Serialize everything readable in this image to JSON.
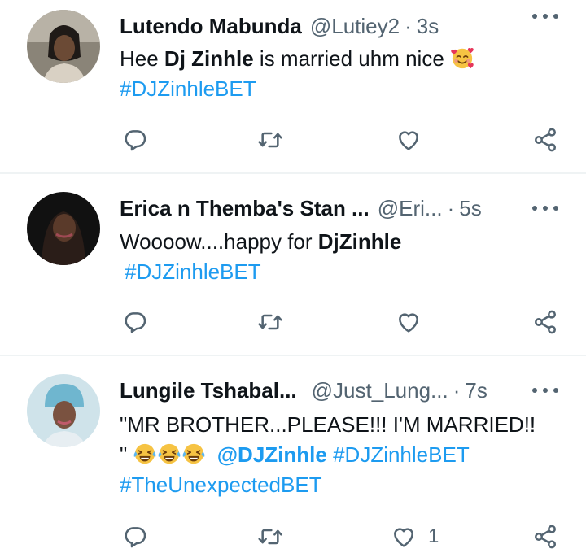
{
  "colors": {
    "link": "#1d9bf0",
    "muted": "#536471",
    "text": "#0f1419",
    "divider": "#eff3f4"
  },
  "tweets": [
    {
      "name": "Lutendo Mabunda",
      "handle": "@Lutiey2",
      "separator": "·",
      "time": "3s",
      "text_plain_1": "Hee ",
      "text_bold_1": "Dj Zinhle",
      "text_plain_2": " is married uhm nice ",
      "emoji": "smiling-face-with-hearts",
      "hashtag_1": "#DJZinhleBET",
      "like_count": ""
    },
    {
      "name": "Erica n Themba's Stan ...",
      "handle": "@Eri...",
      "separator": "·",
      "time": "5s",
      "text_plain_1": "Woooow....happy for ",
      "text_bold_1": "DjZinhle",
      "hashtag_1": "#DJZinhleBET",
      "like_count": ""
    },
    {
      "name": "Lungile Tshabal...",
      "handle": "@Just_Lung...",
      "separator": "·",
      "time": "7s",
      "text_line_1": "\"MR BROTHER...PLEASE!!! I'M MARRIED!!",
      "text_line_2": "\" ",
      "emoji": "face-with-tears-of-joy",
      "mention": "@DJZinhle",
      "hashtag_1": "#DJZinhleBET",
      "hashtag_2": "#TheUnexpectedBET",
      "like_count": "1"
    }
  ],
  "icons": [
    "reply-icon",
    "retweet-icon",
    "like-icon",
    "share-icon",
    "more-icon"
  ]
}
